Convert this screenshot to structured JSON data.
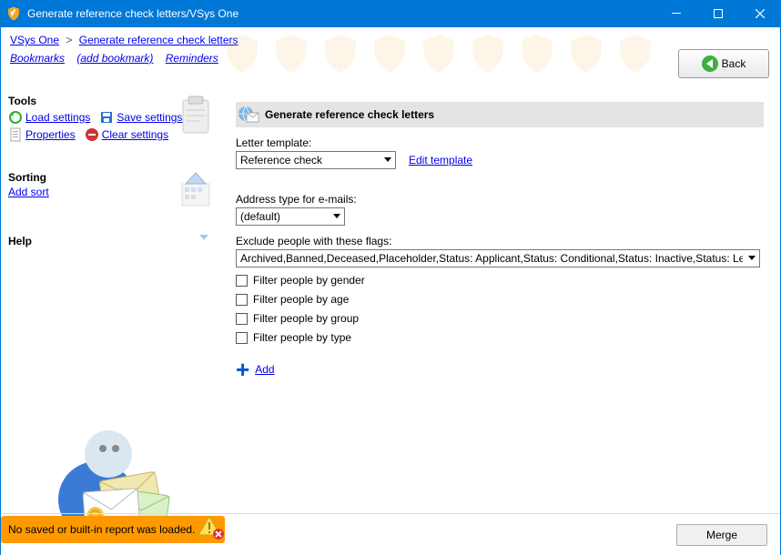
{
  "window": {
    "title": "Generate reference check letters/VSys One"
  },
  "breadcrumb": {
    "root": "VSys One",
    "current": "Generate reference check letters"
  },
  "bookmarks": {
    "bookmarks": "Bookmarks",
    "add": "(add bookmark)",
    "reminders": "Reminders"
  },
  "back": {
    "label": "Back"
  },
  "sidebar": {
    "tools": {
      "heading": "Tools",
      "load": "Load settings",
      "save": "Save settings",
      "properties": "Properties",
      "clear": "Clear settings"
    },
    "sorting": {
      "heading": "Sorting",
      "add_sort": "Add sort"
    },
    "help": {
      "heading": "Help"
    }
  },
  "form": {
    "title": "Generate reference check letters",
    "letter_template_label": "Letter template:",
    "letter_template_value": "Reference check",
    "edit_template": "Edit template",
    "address_type_label": "Address type for e-mails:",
    "address_type_value": "(default)",
    "exclude_flags_label": "Exclude people with these flags:",
    "exclude_flags_value": "Archived,Banned,Deceased,Placeholder,Status: Applicant,Status: Conditional,Status: Inactive,Status: Leave of abs",
    "filters": {
      "gender": "Filter people by gender",
      "age": "Filter people by age",
      "group": "Filter people by group",
      "type": "Filter people by type"
    },
    "add": "Add"
  },
  "footer": {
    "merge": "Merge"
  },
  "toast": {
    "message": "No saved or built-in report was loaded."
  }
}
